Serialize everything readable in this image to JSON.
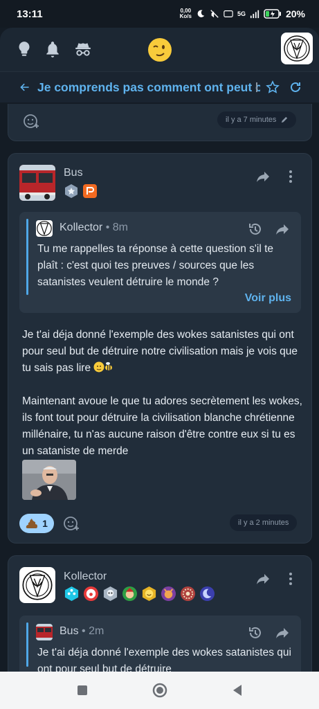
{
  "status": {
    "time": "13:11",
    "speed_value": "0,00",
    "speed_unit": "Ko/s",
    "network": "5G",
    "battery": "20%"
  },
  "appbar": {
    "icons": [
      "lightbulb-icon",
      "bell-icon",
      "incognito-icon"
    ],
    "center_icon": "wink-face-icon"
  },
  "thread": {
    "title": "Je comprends pas comment ont peut cro",
    "back_icon": "arrow-left-icon",
    "star_icon": "star-icon",
    "refresh_icon": "refresh-icon"
  },
  "first_card": {
    "time": "il y a 7 minutes"
  },
  "post_bus": {
    "author": "Bus",
    "quote": {
      "author": "Kollector",
      "time": "• 8m",
      "text": "Tu me rappelles ta réponse à cette question s'il te plaît : c'est quoi tes preuves / sources que les satanistes veulent détruire le monde ?",
      "more": "Voir plus"
    },
    "paragraph1": "Je t'ai déja donné l'exemple des wokes satanistes qui ont pour seul but de détruire notre civilisation mais je vois que tu sais pas lire",
    "paragraph2": "Maintenant avoue le que tu adores secrètement les wokes, ils font tout pour détruire la civilisation blanche chrétienne millénaire, tu n'as aucune raison d'être contre eux si tu es un sataniste de merde",
    "reaction_count": "1",
    "time": "il y a 2 minutes"
  },
  "post_kollector": {
    "author": "Kollector",
    "quote": {
      "author": "Bus",
      "time": "• 2m",
      "text": "Je t'ai déja donné l'exemple des wokes satanistes qui ont pour seul but de détruire"
    }
  },
  "colors": {
    "accent": "#5fb3ee",
    "background": "#141c25",
    "card": "#212d3a"
  }
}
